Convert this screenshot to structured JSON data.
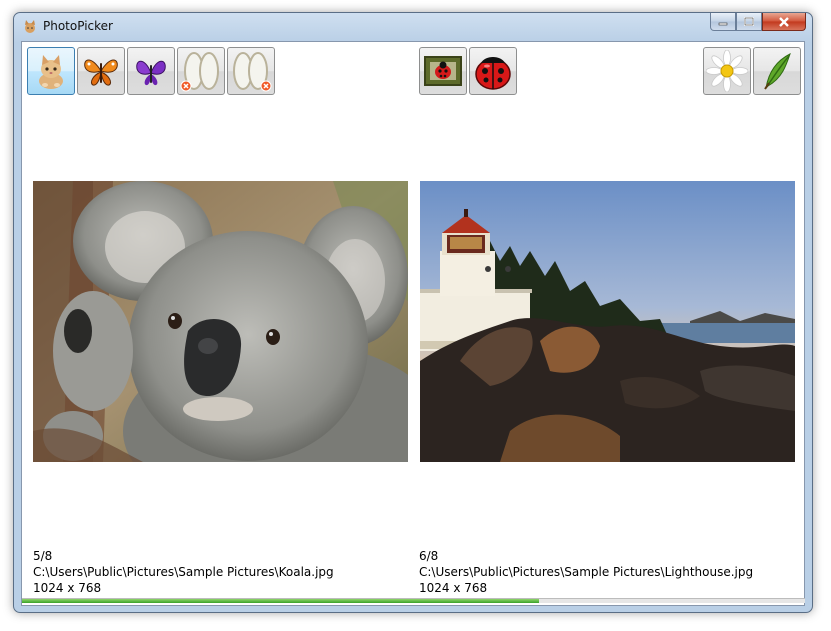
{
  "window": {
    "title": "PhotoPicker"
  },
  "toolbar": {
    "left_buttons": [
      {
        "name": "cat-button",
        "icon": "cat-icon",
        "active": true
      },
      {
        "name": "butterfly-button",
        "icon": "butterfly-icon",
        "active": false
      },
      {
        "name": "purple-butterfly-button",
        "icon": "purple-butterfly-icon",
        "active": false
      },
      {
        "name": "clear-selection-button",
        "icon": "oval-frames-remove-icon",
        "active": false
      },
      {
        "name": "clear-all-button",
        "icon": "oval-frames-remove-icon",
        "active": false
      }
    ],
    "middle_buttons": [
      {
        "name": "ladybug-framed-button",
        "icon": "framed-ladybug-icon"
      },
      {
        "name": "ladybug-button",
        "icon": "ladybug-icon"
      }
    ],
    "right_buttons": [
      {
        "name": "daisy-button",
        "icon": "daisy-icon"
      },
      {
        "name": "feather-button",
        "icon": "feather-icon"
      }
    ]
  },
  "left_photo": {
    "subject": "koala",
    "index": "5/8",
    "path": "C:\\Users\\Public\\Pictures\\Sample Pictures\\Koala.jpg",
    "dimensions": "1024 x 768"
  },
  "right_photo": {
    "subject": "lighthouse",
    "index": "6/8",
    "path": "C:\\Users\\Public\\Pictures\\Sample Pictures\\Lighthouse.jpg",
    "dimensions": "1024 x 768"
  },
  "progress": {
    "fraction": 0.66,
    "color": "#3aa32a"
  }
}
